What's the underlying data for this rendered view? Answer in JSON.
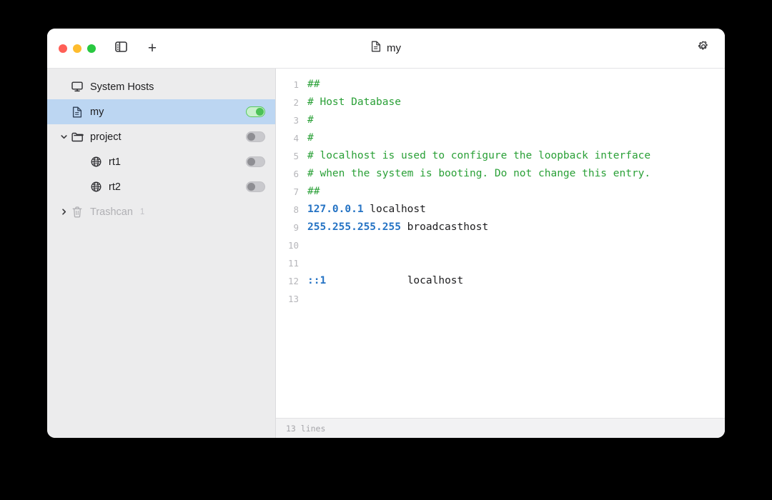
{
  "window": {
    "title": "my",
    "title_icon": "document-icon"
  },
  "titlebar": {
    "traffic_lights": [
      {
        "name": "close",
        "color": "#ff5f57"
      },
      {
        "name": "minimize",
        "color": "#febc2e"
      },
      {
        "name": "maximize",
        "color": "#28c840"
      }
    ],
    "sidebar_toggle_icon": "sidebar-toggle-icon",
    "new_tab_label": "+",
    "settings_icon": "gear-icon"
  },
  "sidebar": {
    "items": [
      {
        "label": "System Hosts",
        "icon": "display-icon",
        "indent": 0,
        "twisty": "none",
        "selected": false,
        "toggle": "none",
        "dim": false,
        "badge": ""
      },
      {
        "label": "my",
        "icon": "document-icon",
        "indent": 0,
        "twisty": "none",
        "selected": true,
        "toggle": "on",
        "dim": false,
        "badge": ""
      },
      {
        "label": "project",
        "icon": "folder-icon",
        "indent": 0,
        "twisty": "expanded",
        "selected": false,
        "toggle": "off",
        "dim": false,
        "badge": ""
      },
      {
        "label": "rt1",
        "icon": "globe-icon",
        "indent": 1,
        "twisty": "none",
        "selected": false,
        "toggle": "off",
        "dim": false,
        "badge": ""
      },
      {
        "label": "rt2",
        "icon": "globe-icon",
        "indent": 1,
        "twisty": "none",
        "selected": false,
        "toggle": "off",
        "dim": false,
        "badge": ""
      },
      {
        "label": "Trashcan",
        "icon": "trash-icon",
        "indent": 0,
        "twisty": "collapsed",
        "selected": false,
        "toggle": "none",
        "dim": true,
        "badge": "1"
      }
    ]
  },
  "editor": {
    "line_numbers": [
      "1",
      "2",
      "3",
      "4",
      "5",
      "6",
      "7",
      "8",
      "9",
      "10",
      "11",
      "12",
      "13"
    ],
    "lines": [
      {
        "n": 1,
        "segments": [
          {
            "type": "comment",
            "text": "##"
          }
        ]
      },
      {
        "n": 2,
        "segments": [
          {
            "type": "comment",
            "text": "# Host Database"
          }
        ]
      },
      {
        "n": 3,
        "segments": [
          {
            "type": "comment",
            "text": "#"
          }
        ]
      },
      {
        "n": 4,
        "segments": [
          {
            "type": "comment",
            "text": "#"
          }
        ]
      },
      {
        "n": 5,
        "segments": [
          {
            "type": "comment",
            "text": "# localhost is used to configure the loopback interface"
          }
        ]
      },
      {
        "n": 6,
        "segments": [
          {
            "type": "comment",
            "text": "# when the system is booting. Do not change this entry."
          }
        ]
      },
      {
        "n": 7,
        "segments": [
          {
            "type": "comment",
            "text": "##"
          }
        ]
      },
      {
        "n": 8,
        "segments": [
          {
            "type": "ip",
            "text": "127.0.0.1"
          },
          {
            "type": "host",
            "text": " localhost"
          }
        ]
      },
      {
        "n": 9,
        "segments": [
          {
            "type": "ip",
            "text": "255.255.255.255"
          },
          {
            "type": "host",
            "text": " broadcasthost"
          }
        ]
      },
      {
        "n": 10,
        "segments": [
          {
            "type": "host",
            "text": ""
          }
        ]
      },
      {
        "n": 11,
        "segments": [
          {
            "type": "host",
            "text": ""
          }
        ]
      },
      {
        "n": 12,
        "segments": [
          {
            "type": "ip",
            "text": "::1"
          },
          {
            "type": "host",
            "text": "             localhost"
          }
        ]
      },
      {
        "n": 13,
        "segments": [
          {
            "type": "host",
            "text": ""
          }
        ]
      }
    ]
  },
  "statusbar": {
    "text": "13 lines"
  },
  "colors": {
    "comment_green": "#2aa037",
    "ip_blue": "#2573c4",
    "selection_blue": "#bcd6f2",
    "sidebar_bg": "#ececed",
    "toggle_on_green": "#4cc257"
  }
}
